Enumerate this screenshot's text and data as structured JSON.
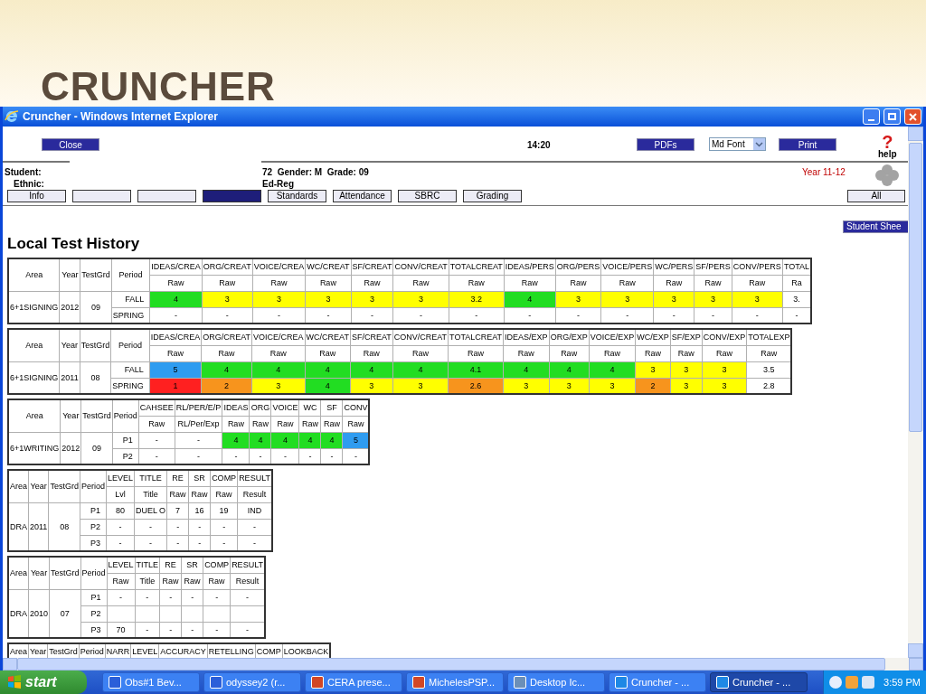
{
  "slide": {
    "title": "CRUNCHER"
  },
  "window": {
    "title": "Cruncher - Windows Internet Explorer"
  },
  "toolbar": {
    "close": "Close",
    "time": "14:20",
    "pdfs": "PDFs",
    "font_select": "Md Font",
    "print": "Print",
    "help_glyph": "?",
    "help_label": "help"
  },
  "student": {
    "student_label": "Student:",
    "ethnic_label": "Ethnic:",
    "details": "72  Gender: M  Grade: 09",
    "program": "Ed-Reg",
    "year": "Year 11-12"
  },
  "tabs": [
    {
      "label": "Info",
      "selected": false
    },
    {
      "selected": false
    },
    {
      "selected": false
    },
    {
      "selected": true
    },
    {
      "label": "Standards",
      "selected": false
    },
    {
      "label": "Attendance",
      "selected": false
    },
    {
      "label": "SBRC",
      "selected": false
    },
    {
      "label": "Grading",
      "selected": false
    }
  ],
  "all_button": "All",
  "student_sheet_button": "Student Shee",
  "heading": "Local Test History",
  "tables": [
    {
      "headers": [
        "Area",
        "Year",
        "TestGrd",
        "Period"
      ],
      "area": "6+1SIGNING",
      "year": "2012",
      "testgrd": "09",
      "columns": [
        {
          "label": "IDEAS/CREA",
          "sub": "Raw"
        },
        {
          "label": "ORG/CREAT",
          "sub": "Raw"
        },
        {
          "label": "VOICE/CREA",
          "sub": "Raw"
        },
        {
          "label": "WC/CREAT",
          "sub": "Raw"
        },
        {
          "label": "SF/CREAT",
          "sub": "Raw"
        },
        {
          "label": "CONV/CREAT",
          "sub": "Raw"
        },
        {
          "label": "TOTALCREAT",
          "sub": "Raw"
        },
        {
          "label": "IDEAS/PERS",
          "sub": "Raw"
        },
        {
          "label": "ORG/PERS",
          "sub": "Raw"
        },
        {
          "label": "VOICE/PERS",
          "sub": "Raw"
        },
        {
          "label": "WC/PERS",
          "sub": "Raw"
        },
        {
          "label": "SF/PERS",
          "sub": "Raw"
        },
        {
          "label": "CONV/PERS",
          "sub": "Raw"
        },
        {
          "label": "TOTAL",
          "sub": "Ra"
        }
      ],
      "rows": [
        {
          "period": "FALL",
          "cells": [
            {
              "value": "4",
              "color": "#22dd22"
            },
            {
              "value": "3",
              "color": "#ffff00"
            },
            {
              "value": "3",
              "color": "#ffff00"
            },
            {
              "value": "3",
              "color": "#ffff00"
            },
            {
              "value": "3",
              "color": "#ffff00"
            },
            {
              "value": "3",
              "color": "#ffff00"
            },
            {
              "value": "3.2",
              "color": "#ffff00"
            },
            {
              "value": "4",
              "color": "#22dd22"
            },
            {
              "value": "3",
              "color": "#ffff00"
            },
            {
              "value": "3",
              "color": "#ffff00"
            },
            {
              "value": "3",
              "color": "#ffff00"
            },
            {
              "value": "3",
              "color": "#ffff00"
            },
            {
              "value": "3",
              "color": "#ffff00"
            },
            {
              "value": "3."
            }
          ]
        },
        {
          "period": "SPRING",
          "cells": [
            {
              "value": "-"
            },
            {
              "value": "-"
            },
            {
              "value": "-"
            },
            {
              "value": "-"
            },
            {
              "value": "-"
            },
            {
              "value": "-"
            },
            {
              "value": "-"
            },
            {
              "value": "-"
            },
            {
              "value": "-"
            },
            {
              "value": "-"
            },
            {
              "value": "-"
            },
            {
              "value": "-"
            },
            {
              "value": "-"
            },
            {
              "value": "-"
            }
          ]
        }
      ]
    },
    {
      "headers": [
        "Area",
        "Year",
        "TestGrd",
        "Period"
      ],
      "area": "6+1SIGNING",
      "year": "2011",
      "testgrd": "08",
      "columns": [
        {
          "label": "IDEAS/CREA",
          "sub": "Raw"
        },
        {
          "label": "ORG/CREAT",
          "sub": "Raw"
        },
        {
          "label": "VOICE/CREA",
          "sub": "Raw"
        },
        {
          "label": "WC/CREAT",
          "sub": "Raw"
        },
        {
          "label": "SF/CREAT",
          "sub": "Raw"
        },
        {
          "label": "CONV/CREAT",
          "sub": "Raw"
        },
        {
          "label": "TOTALCREAT",
          "sub": "Raw"
        },
        {
          "label": "IDEAS/EXP",
          "sub": "Raw"
        },
        {
          "label": "ORG/EXP",
          "sub": "Raw"
        },
        {
          "label": "VOICE/EXP",
          "sub": "Raw"
        },
        {
          "label": "WC/EXP",
          "sub": "Raw"
        },
        {
          "label": "SF/EXP",
          "sub": "Raw"
        },
        {
          "label": "CONV/EXP",
          "sub": "Raw"
        },
        {
          "label": "TOTALEXP",
          "sub": "Raw"
        }
      ],
      "rows": [
        {
          "period": "FALL",
          "cells": [
            {
              "value": "5",
              "color": "#2f9cf0"
            },
            {
              "value": "4",
              "color": "#22dd22"
            },
            {
              "value": "4",
              "color": "#22dd22"
            },
            {
              "value": "4",
              "color": "#22dd22"
            },
            {
              "value": "4",
              "color": "#22dd22"
            },
            {
              "value": "4",
              "color": "#22dd22"
            },
            {
              "value": "4.1",
              "color": "#22dd22"
            },
            {
              "value": "4",
              "color": "#22dd22"
            },
            {
              "value": "4",
              "color": "#22dd22"
            },
            {
              "value": "4",
              "color": "#22dd22"
            },
            {
              "value": "3",
              "color": "#ffff00"
            },
            {
              "value": "3",
              "color": "#ffff00"
            },
            {
              "value": "3",
              "color": "#ffff00"
            },
            {
              "value": "3.5"
            }
          ]
        },
        {
          "period": "SPRING",
          "cells": [
            {
              "value": "1",
              "color": "#ff2020"
            },
            {
              "value": "2",
              "color": "#f7941d"
            },
            {
              "value": "3",
              "color": "#ffff00"
            },
            {
              "value": "4",
              "color": "#22dd22"
            },
            {
              "value": "3",
              "color": "#ffff00"
            },
            {
              "value": "3",
              "color": "#ffff00"
            },
            {
              "value": "2.6",
              "color": "#f7941d"
            },
            {
              "value": "3",
              "color": "#ffff00"
            },
            {
              "value": "3",
              "color": "#ffff00"
            },
            {
              "value": "3",
              "color": "#ffff00"
            },
            {
              "value": "2",
              "color": "#f7941d"
            },
            {
              "value": "3",
              "color": "#ffff00"
            },
            {
              "value": "3",
              "color": "#ffff00"
            },
            {
              "value": "2.8"
            }
          ]
        }
      ]
    },
    {
      "headers": [
        "Area",
        "Year",
        "TestGrd",
        "Period"
      ],
      "area": "6+1WRITING",
      "year": "2012",
      "testgrd": "09",
      "columns": [
        {
          "label": "CAHSEE",
          "sub": "Raw"
        },
        {
          "label": "RL/PER/E/P",
          "sub": "RL/Per/Exp"
        },
        {
          "label": "IDEAS",
          "sub": "Raw"
        },
        {
          "label": "ORG",
          "sub": "Raw"
        },
        {
          "label": "VOICE",
          "sub": "Raw"
        },
        {
          "label": "WC",
          "sub": "Raw"
        },
        {
          "label": "SF",
          "sub": "Raw"
        },
        {
          "label": "CONV",
          "sub": "Raw"
        }
      ],
      "rows": [
        {
          "period": "P1",
          "cells": [
            {
              "value": "-"
            },
            {
              "value": "-"
            },
            {
              "value": "4",
              "color": "#22dd22"
            },
            {
              "value": "4",
              "color": "#22dd22"
            },
            {
              "value": "4",
              "color": "#22dd22"
            },
            {
              "value": "4",
              "color": "#22dd22"
            },
            {
              "value": "4",
              "color": "#22dd22"
            },
            {
              "value": "5",
              "color": "#2f9cf0"
            }
          ]
        },
        {
          "period": "P2",
          "cells": [
            {
              "value": "-"
            },
            {
              "value": "-"
            },
            {
              "value": "-"
            },
            {
              "value": "-"
            },
            {
              "value": "-"
            },
            {
              "value": "-"
            },
            {
              "value": "-"
            },
            {
              "value": "-"
            }
          ]
        }
      ]
    },
    {
      "headers": [
        "Area",
        "Year",
        "TestGrd",
        "Period"
      ],
      "area": "DRA",
      "year": "2011",
      "testgrd": "08",
      "columns": [
        {
          "label": "LEVEL",
          "sub": "Lvl"
        },
        {
          "label": "TITLE",
          "sub": "Title"
        },
        {
          "label": "RE",
          "sub": "Raw"
        },
        {
          "label": "SR",
          "sub": "Raw"
        },
        {
          "label": "COMP",
          "sub": "Raw"
        },
        {
          "label": "RESULT",
          "sub": "Result"
        }
      ],
      "rows": [
        {
          "period": "P1",
          "cells": [
            {
              "value": "80"
            },
            {
              "value": "DUEL O"
            },
            {
              "value": "7"
            },
            {
              "value": "16"
            },
            {
              "value": "19"
            },
            {
              "value": "IND"
            }
          ]
        },
        {
          "period": "P2",
          "cells": [
            {
              "value": "-"
            },
            {
              "value": "-"
            },
            {
              "value": "-"
            },
            {
              "value": "-"
            },
            {
              "value": "-"
            },
            {
              "value": "-"
            }
          ]
        },
        {
          "period": "P3",
          "cells": [
            {
              "value": "-"
            },
            {
              "value": "-"
            },
            {
              "value": "-"
            },
            {
              "value": "-"
            },
            {
              "value": "-"
            },
            {
              "value": "-"
            }
          ]
        }
      ]
    },
    {
      "headers": [
        "Area",
        "Year",
        "TestGrd",
        "Period"
      ],
      "area": "DRA",
      "year": "2010",
      "testgrd": "07",
      "columns": [
        {
          "label": "LEVEL",
          "sub": "Raw"
        },
        {
          "label": "TITLE",
          "sub": "Title"
        },
        {
          "label": "RE",
          "sub": "Raw"
        },
        {
          "label": "SR",
          "sub": "Raw"
        },
        {
          "label": "COMP",
          "sub": "Raw"
        },
        {
          "label": "RESULT",
          "sub": "Result"
        }
      ],
      "rows": [
        {
          "period": "P1",
          "cells": [
            {
              "value": "-"
            },
            {
              "value": "-"
            },
            {
              "value": "-"
            },
            {
              "value": "-"
            },
            {
              "value": "-"
            },
            {
              "value": "-"
            }
          ]
        },
        {
          "period": "P2",
          "cells": [
            {},
            {},
            {},
            {},
            {},
            {}
          ]
        },
        {
          "period": "P3",
          "cells": [
            {
              "value": "70"
            },
            {
              "value": "-"
            },
            {
              "value": "-"
            },
            {
              "value": "-"
            },
            {
              "value": "-"
            },
            {
              "value": "-"
            }
          ]
        }
      ]
    },
    {
      "headers": [
        "Area",
        "Year",
        "TestGrd",
        "Period"
      ],
      "columns": [
        {
          "label": "NARR"
        },
        {
          "label": "LEVEL"
        },
        {
          "label": "ACCURACY"
        },
        {
          "label": "RETELLING"
        },
        {
          "label": "COMP"
        },
        {
          "label": "LOOKBACK"
        }
      ]
    }
  ],
  "taskbar": {
    "start": "start",
    "items": [
      {
        "label": "Obs#1 Bev...",
        "kind": "word",
        "selected": false
      },
      {
        "label": "odyssey2 (r...",
        "kind": "word",
        "selected": false
      },
      {
        "label": "CERA prese...",
        "kind": "slides",
        "selected": false
      },
      {
        "label": "MichelesPSP...",
        "kind": "slides",
        "selected": false
      },
      {
        "label": "Desktop Ic...",
        "kind": "desktop",
        "selected": false
      },
      {
        "label": "Cruncher - ...",
        "kind": "browser",
        "selected": false
      },
      {
        "label": "Cruncher - ...",
        "kind": "browser",
        "selected": true
      }
    ],
    "clock": "3:59 PM"
  }
}
